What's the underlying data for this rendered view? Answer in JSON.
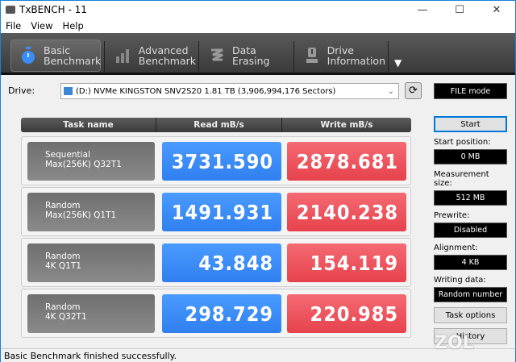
{
  "window": {
    "title": "TxBENCH - 11",
    "minimize": "—",
    "maximize": "☐",
    "close": "✕"
  },
  "menu": [
    "File",
    "View",
    "Help"
  ],
  "tabs": [
    {
      "l1": "Basic",
      "l2": "Benchmark",
      "icon": "stopwatch-icon"
    },
    {
      "l1": "Advanced",
      "l2": "Benchmark",
      "icon": "bar-chart-icon"
    },
    {
      "l1": "Data Erasing",
      "l2": "",
      "icon": "eraser-icon"
    },
    {
      "l1": "Drive",
      "l2": "Information",
      "icon": "drive-info-icon"
    }
  ],
  "drive": {
    "label": "Drive:",
    "value": "(D:) NVMe KINGSTON SNV2S20  1.81 TB (3,906,994,176 Sectors)",
    "mode": "FILE mode"
  },
  "table": {
    "headers": [
      "Task name",
      "Read mB/s",
      "Write mB/s"
    ],
    "rows": [
      {
        "l1": "Sequential",
        "l2": "Max(256K) Q32T1",
        "read": "3731.590",
        "write": "2878.681"
      },
      {
        "l1": "Random",
        "l2": "Max(256K) Q1T1",
        "read": "1491.931",
        "write": "2140.238"
      },
      {
        "l1": "Random",
        "l2": "4K Q1T1",
        "read": "43.848",
        "write": "154.119"
      },
      {
        "l1": "Random",
        "l2": "4K Q32T1",
        "read": "298.729",
        "write": "220.985"
      }
    ]
  },
  "panel": {
    "start": "Start",
    "start_pos_label": "Start position:",
    "start_pos": "0 MB",
    "size_label": "Measurement size:",
    "size": "512 MB",
    "prewrite_label": "Prewrite:",
    "prewrite": "Disabled",
    "align_label": "Alignment:",
    "align": "4 KB",
    "wdata_label": "Writing data:",
    "wdata": "Random number",
    "task_options": "Task options",
    "history": "History"
  },
  "status": "Basic Benchmark finished successfully.",
  "watermark": "ZOL",
  "colors": {
    "read": "#3a8cf8",
    "write": "#ee5059",
    "toolbar": "#4a4a4a"
  }
}
